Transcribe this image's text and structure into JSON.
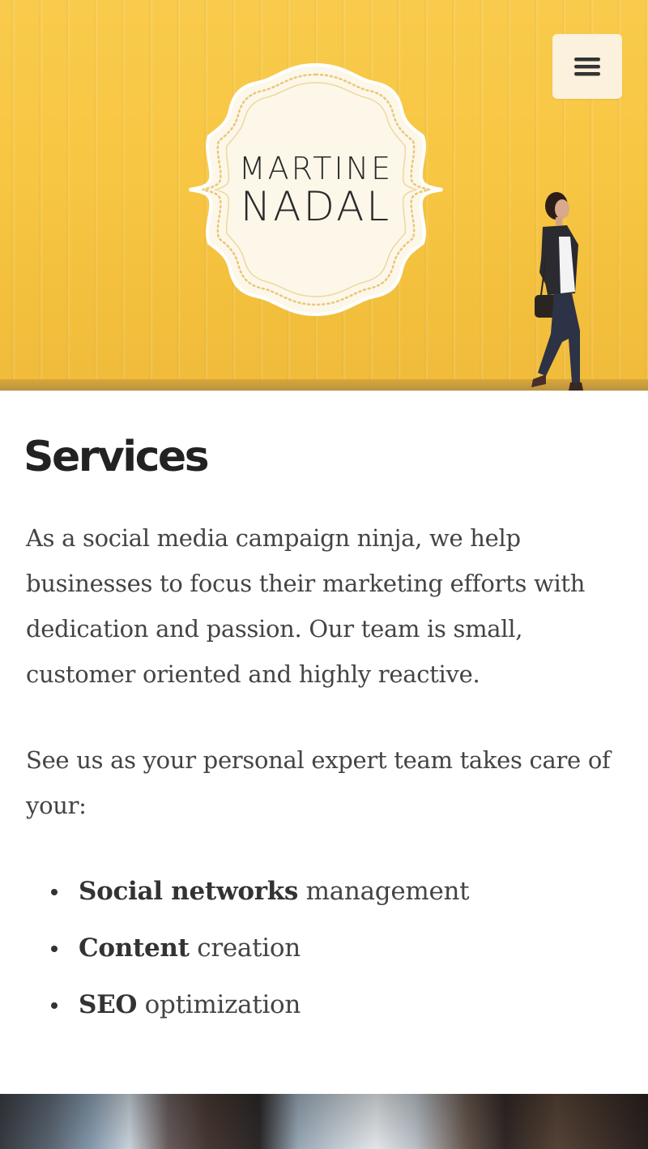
{
  "header": {
    "menu_icon": "hamburger-menu-icon",
    "logo": {
      "line1": "MARTINE",
      "line2": "NADAL"
    },
    "hero_colors": {
      "accent": "#f8c847",
      "menu_bg": "#fbf1dc",
      "badge_bg": "#fdf6e8"
    }
  },
  "services": {
    "title": "Services",
    "paragraph1": "As a social media campaign ninja, we help businesses to focus their marketing efforts with dedication and passion. Our team is small, customer oriented and highly reactive.",
    "paragraph2": "See us as your personal expert team takes care of your:",
    "items": [
      {
        "bold": "Social networks",
        "rest": " management"
      },
      {
        "bold": "Content",
        "rest": " creation"
      },
      {
        "bold": "SEO",
        "rest": " optimization"
      }
    ]
  }
}
